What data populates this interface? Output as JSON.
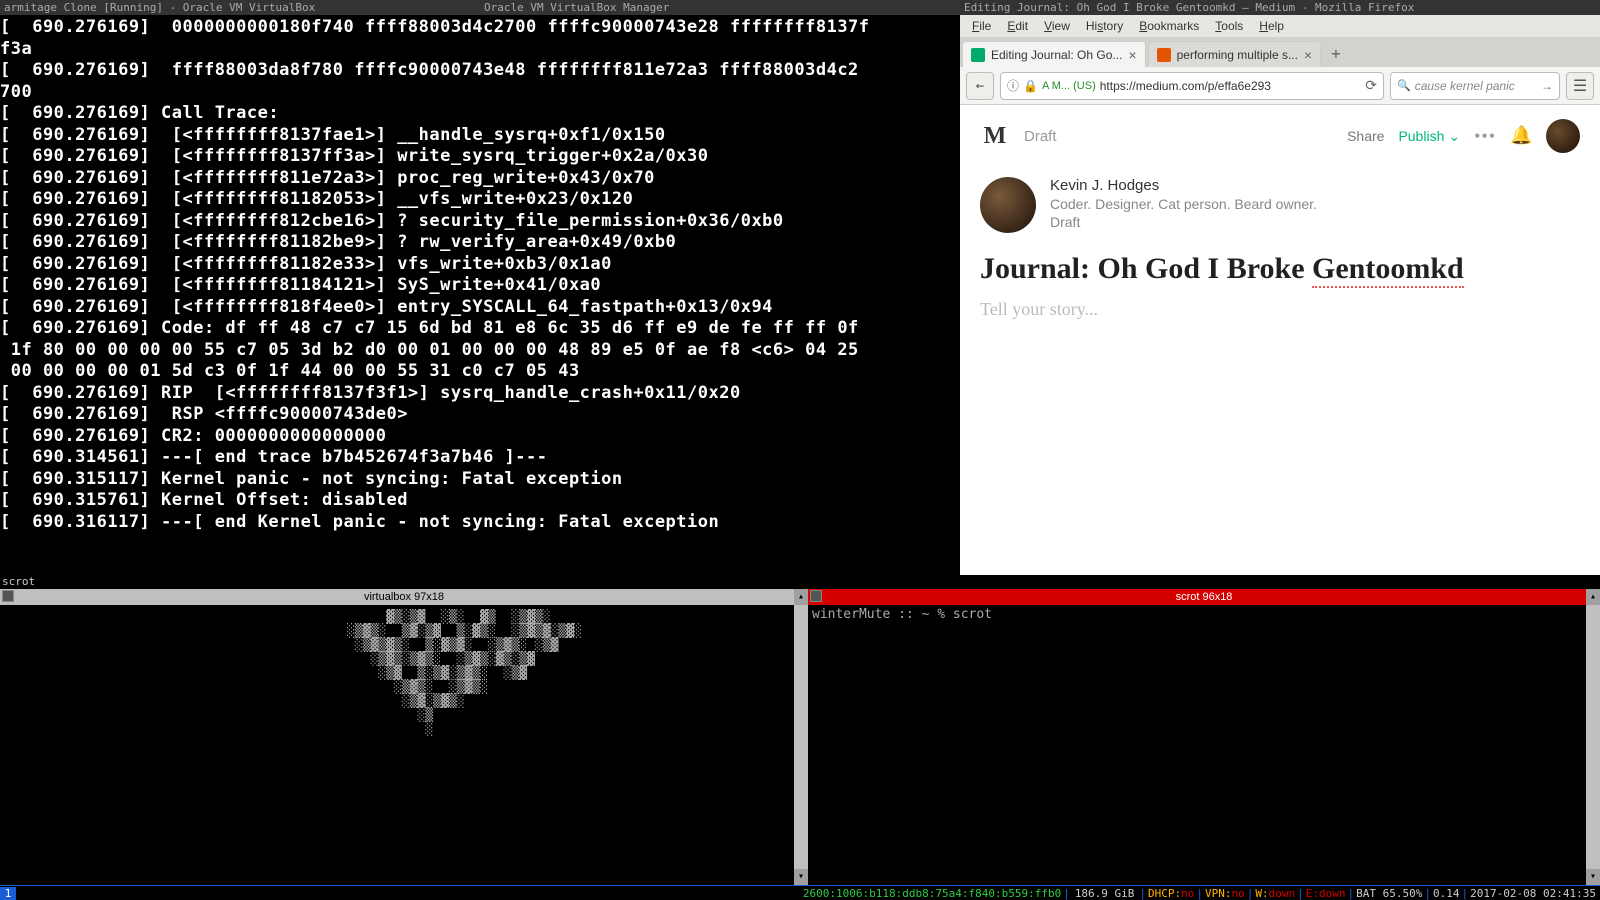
{
  "titlebars": {
    "vm": "armitage Clone [Running] - Oracle VM VirtualBox",
    "manager": "Oracle VM VirtualBox Manager",
    "firefox": "Editing Journal: Oh God I Broke Gentoomkd — Medium - Mozilla Firefox"
  },
  "kernel_panic": "[  690.276169]  0000000000180f740 ffff88003d4c2700 ffffc90000743e28 ffffffff8137f\nf3a\n[  690.276169]  ffff88003da8f780 ffffc90000743e48 ffffffff811e72a3 ffff88003d4c2\n700\n[  690.276169] Call Trace:\n[  690.276169]  [<ffffffff8137fae1>] __handle_sysrq+0xf1/0x150\n[  690.276169]  [<ffffffff8137ff3a>] write_sysrq_trigger+0x2a/0x30\n[  690.276169]  [<ffffffff811e72a3>] proc_reg_write+0x43/0x70\n[  690.276169]  [<ffffffff81182053>] __vfs_write+0x23/0x120\n[  690.276169]  [<ffffffff812cbe16>] ? security_file_permission+0x36/0xb0\n[  690.276169]  [<ffffffff81182be9>] ? rw_verify_area+0x49/0xb0\n[  690.276169]  [<ffffffff81182e33>] vfs_write+0xb3/0x1a0\n[  690.276169]  [<ffffffff81184121>] SyS_write+0x41/0xa0\n[  690.276169]  [<ffffffff818f4ee0>] entry_SYSCALL_64_fastpath+0x13/0x94\n[  690.276169] Code: df ff 48 c7 c7 15 6d bd 81 e8 6c 35 d6 ff e9 de fe ff ff 0f\n 1f 80 00 00 00 00 55 c7 05 3d b2 d0 00 01 00 00 00 48 89 e5 0f ae f8 <c6> 04 25\n 00 00 00 00 01 5d c3 0f 1f 44 00 00 55 31 c0 c7 05 43\n[  690.276169] RIP  [<ffffffff8137f3f1>] sysrq_handle_crash+0x11/0x20\n[  690.276169]  RSP <ffffc90000743de0>\n[  690.276169] CR2: 0000000000000000\n[  690.314561] ---[ end trace b7b452674f3a7b46 ]---\n[  690.315117] Kernel panic - not syncing: Fatal exception\n[  690.315761] Kernel Offset: disabled\n[  690.316117] ---[ end Kernel panic - not syncing: Fatal exception\n",
  "firefox": {
    "menus": [
      "File",
      "Edit",
      "View",
      "History",
      "Bookmarks",
      "Tools",
      "Help"
    ],
    "tabs": [
      {
        "label": "Editing Journal: Oh Go...",
        "active": true,
        "favicon": "medium"
      },
      {
        "label": "performing multiple s...",
        "active": false,
        "favicon": "ask"
      }
    ],
    "url_identity": "A M... (US)",
    "url": "https://medium.com/p/effa6e293",
    "search": "cause kernel panic"
  },
  "medium": {
    "draft_label": "Draft",
    "share": "Share",
    "publish": "Publish",
    "author_name": "Kevin J. Hodges",
    "author_bio": "Coder. Designer. Cat person. Beard owner.",
    "author_meta": "Draft",
    "title_pre": "Journal: Oh God I Broke ",
    "title_squiggle": "Gentoomkd",
    "body_placeholder": "Tell your story..."
  },
  "scrot_label": "scrot",
  "terminals": {
    "left_title": "virtualbox 97x18",
    "right_title": "scrot 96x18",
    "right_prompt": "winterMute :: ~ % scrot",
    "ascii_noise": "           ▓▒░▒▓  ░▒░  ▓▒  ░▒▓▒░\n      ░▒▓▒░  ▒▓░▒▓  ▒░▓▒░  ░▒▓▒▓░▒▓░\n       ░▒▓▒▓▒░  ▒░▓▒▓░  ░▒▓▒░ ░▒▓\n         ░▒▓▒░▒▓▒░  ░▒▓▒░▓▒░▒▓\n          ░▒▓  ▒░▒▓░▒▓▒░  ░▒▓\n            ░▒▓▒░  ░▒▓▒░\n             ░▒▓░▒▓▒░\n               ░▒\n                ░"
  },
  "statusbar": {
    "workspace": "1",
    "ipv6": "2600:1006:b118:ddb8:75a4:f840:b559:ffb0",
    "mem": "186.9 GiB",
    "dhcp_label": "DHCP:",
    "dhcp_val": " no",
    "vpn_label": "VPN:",
    "vpn_val": " no",
    "w_label": "W:",
    "w_val": " down",
    "e_label": "E:",
    "e_val": " down",
    "bat": "BAT 65.50%",
    "load": "0.14",
    "time": "2017-02-08 02:41:35"
  }
}
